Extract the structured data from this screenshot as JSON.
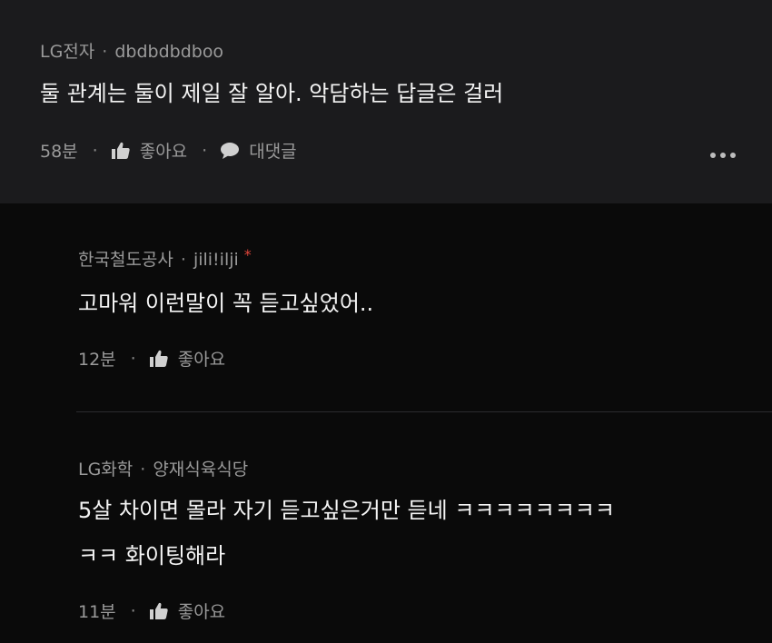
{
  "comments": [
    {
      "author": "LG전자",
      "username": "dbdbdbdboo",
      "text": "둘 관계는 둘이 제일 잘 알아. 악담하는 답글은 걸러",
      "time": "58분",
      "like_label": "좋아요",
      "reply_label": "대댓글"
    },
    {
      "author": "한국철도공사",
      "username": "jili!ilji",
      "text": "고마워 이런말이 꼭 듣고싶었어..",
      "time": "12분",
      "like_label": "좋아요"
    },
    {
      "author": "LG화학",
      "username": "양재식육식당",
      "text_line1": "5살 차이면 몰라 자기 듣고싶은거만 듣네 ㅋㅋㅋㅋㅋㅋㅋㅋ",
      "text_line2": "ㅋㅋ 화이팅해라",
      "time": "11분",
      "like_label": "좋아요"
    }
  ],
  "separator": "·",
  "owner_marker": "*",
  "colors": {
    "top_background": "#1b1b1d",
    "reply_background": "#0a0a0a",
    "meta_text": "#9a9a9a",
    "owner_marker": "#e0453a"
  },
  "icons": {
    "like": "thumbs-up-icon",
    "reply": "speech-bubble-icon",
    "more": "more-options-icon"
  }
}
